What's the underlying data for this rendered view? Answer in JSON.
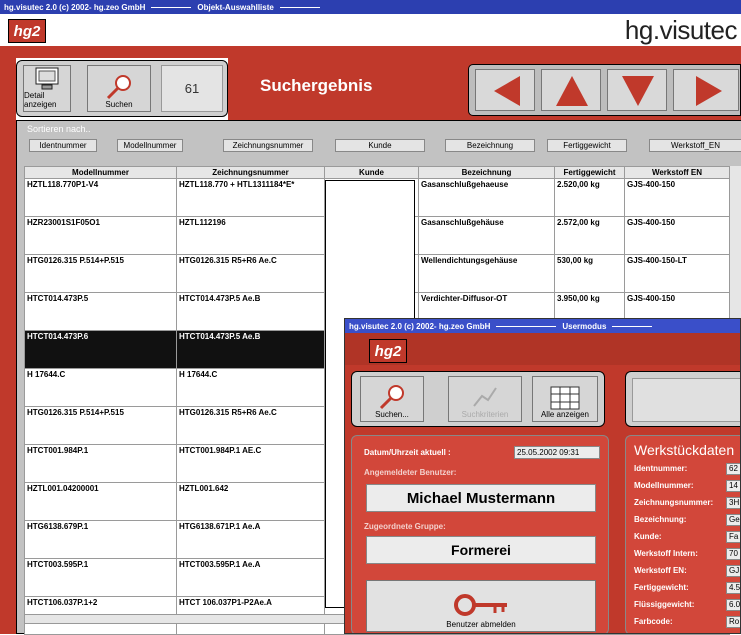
{
  "main_window": {
    "title": "hg.visutec 2.0  (c) 2002- hg.zeo GmbH",
    "subtitle": "Objekt-Auswahlliste",
    "logo_text": "hg2",
    "brand": "hg.visutec",
    "toolbar": {
      "detail_label": "Detail anzeigen",
      "search_label": "Suchen",
      "count": "61",
      "heading": "Suchergebnis"
    },
    "sort": {
      "label": "Sortieren nach..",
      "buttons": [
        "Identnummer",
        "Modellnummer",
        "Zeichnungsnummer",
        "Kunde",
        "Bezeichnung",
        "Fertiggewicht",
        "Werkstoff_EN"
      ]
    },
    "columns": [
      "Modellnummer",
      "Zeichnungsnummer",
      "Kunde",
      "Bezeichnung",
      "Fertiggewicht",
      "Werkstoff EN"
    ],
    "rows": [
      {
        "m": "HZTL118.770P1-V4",
        "z": "HZTL118.770 + HTL1311184*E*",
        "k": "",
        "b": "Gasanschlußgehaeuse",
        "f": "2.520,00 kg",
        "w": "GJS-400-150"
      },
      {
        "m": "HZR23001S1F05O1",
        "z": "HZTL112196",
        "k": "",
        "b": "Gasanschlußgehäuse",
        "f": "2.572,00 kg",
        "w": "GJS-400-150"
      },
      {
        "m": "HTG0126.315 P.514+P.515",
        "z": "HTG0126.315 R5+R6 Ae.C",
        "k": "",
        "b": "Wellendichtungsgehäuse",
        "f": "530,00 kg",
        "w": "GJS-400-150-LT"
      },
      {
        "m": "HTCT014.473P.5",
        "z": "HTCT014.473P.5 Ae.B",
        "k": "",
        "b": "Verdichter-Diffusor-OT",
        "f": "3.950,00 kg",
        "w": "GJS-400-150"
      },
      {
        "m": "HTCT014.473P.6",
        "z": "HTCT014.473P.5 Ae.B",
        "k": "",
        "b": "",
        "f": "",
        "w": "",
        "selected": true
      },
      {
        "m": "H 17644.C",
        "z": "H 17644.C",
        "k": "",
        "b": "",
        "f": "",
        "w": ""
      },
      {
        "m": "HTG0126.315 P.514+P.515",
        "z": "HTG0126.315 R5+R6 Ae.C",
        "k": "",
        "b": "",
        "f": "",
        "w": ""
      },
      {
        "m": "HTCT001.984P.1",
        "z": "HTCT001.984P.1 AE.C",
        "k": "",
        "b": "",
        "f": "",
        "w": ""
      },
      {
        "m": "HZTL001.04200001",
        "z": "HZTL001.642",
        "k": "",
        "b": "",
        "f": "",
        "w": ""
      },
      {
        "m": "HTG6138.679P.1",
        "z": "HTG6138.671P.1 Ae.A",
        "k": "",
        "b": "",
        "f": "",
        "w": ""
      },
      {
        "m": "HTCT003.595P.1",
        "z": "HTCT003.595P.1 Ae.A",
        "k": "",
        "b": "",
        "f": "",
        "w": ""
      },
      {
        "m": "HTCT106.037P.1+2",
        "z": "HTCT 106.037P1-P2Ae.A",
        "k": "",
        "b": "",
        "f": "",
        "w": ""
      }
    ],
    "colors": {
      "titlebar": "#2c3fb0",
      "brand_red": "#c0392b",
      "panel": "#cfcfcf",
      "selected_row": "#111111"
    }
  },
  "user_window": {
    "title": "hg.visutec 2.0  (c) 2002- hg.zeo GmbH",
    "subtitle": "Usermodus",
    "logo_text": "hg2",
    "toolbar": {
      "search_label": "Suchen...",
      "disabled_label": "Suchkriterien",
      "show_all_label": "Alle anzeigen"
    },
    "login": {
      "datetime_label": "Datum/Uhrzeit aktuell :",
      "datetime_value": "25.05.2002  09:31",
      "user_label": "Angemeldeter Benutzer:",
      "user_value": "Michael Mustermann",
      "group_label": "Zugeordnete Gruppe:",
      "group_value": "Formerei",
      "logout_label": "Benutzer abmelden"
    },
    "details": {
      "heading": "Werkstückdaten",
      "fields": [
        "Identnummer:",
        "Modellnummer:",
        "Zeichnungsnummer:",
        "Bezeichnung:",
        "Kunde:",
        "Werkstoff Intern:",
        "Werkstoff EN:",
        "Fertiggewicht:",
        "Flüssiggewicht:",
        "Farbcode:"
      ],
      "values": [
        "62",
        "14",
        "3H",
        "Ge",
        "Fa",
        "70",
        "GJ",
        "4.5",
        "6.0",
        "Ro"
      ]
    }
  }
}
